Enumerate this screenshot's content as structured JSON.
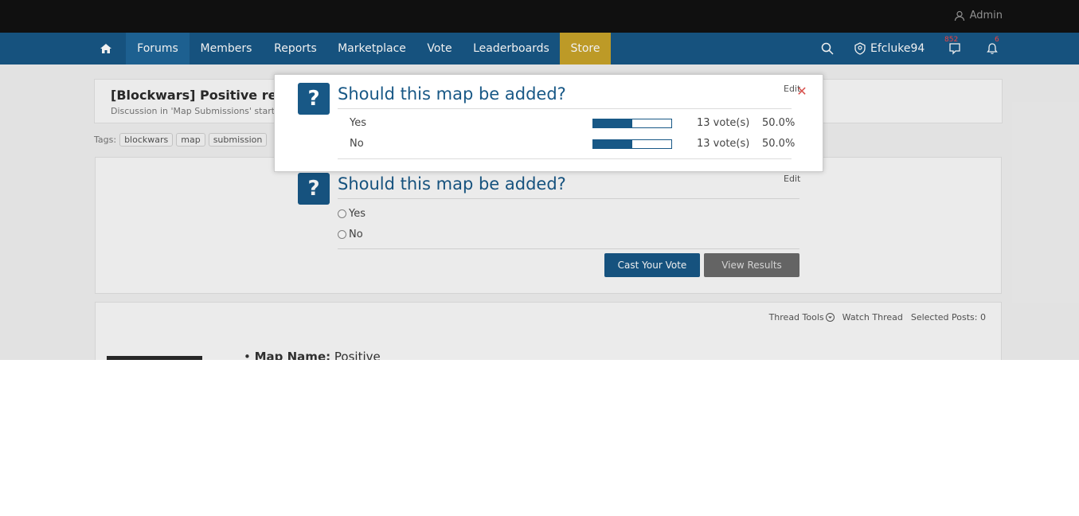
{
  "topbar": {
    "admin_label": "Admin"
  },
  "nav": {
    "forums": "Forums",
    "members": "Members",
    "reports": "Reports",
    "marketplace": "Marketplace",
    "vote": "Vote",
    "leaderboards": "Leaderboards",
    "store": "Store",
    "username": "Efcluke94",
    "conversations_badge": "852",
    "alerts_badge": "6"
  },
  "thread": {
    "title": "[Blockwars] Positive remak",
    "description": "Discussion in 'Map Submissions' started",
    "tags_label": "Tags:",
    "tags": [
      "blockwars",
      "map",
      "submission"
    ]
  },
  "poll": {
    "question": "Should this map be added?",
    "edit_label": "Edit",
    "options": [
      "Yes",
      "No"
    ],
    "cast_vote": "Cast Your Vote",
    "view_results": "View Results"
  },
  "thread_tools": {
    "tools": "Thread Tools",
    "watch": "Watch Thread",
    "selected": "Selected Posts: 0"
  },
  "post": {
    "map_name_label": "Map Name:",
    "map_name_value": "Positive"
  },
  "modal": {
    "question": "Should this map be added?",
    "edit_label": "Edit",
    "results": [
      {
        "label": "Yes",
        "votes": "13 vote(s)",
        "percent": "50.0%",
        "fraction": 0.5
      },
      {
        "label": "No",
        "votes": "13 vote(s)",
        "percent": "50.0%",
        "fraction": 0.5
      }
    ]
  },
  "colors": {
    "nav_bg": "#185886",
    "store_bg": "#c9a42a",
    "accent": "#185886"
  }
}
